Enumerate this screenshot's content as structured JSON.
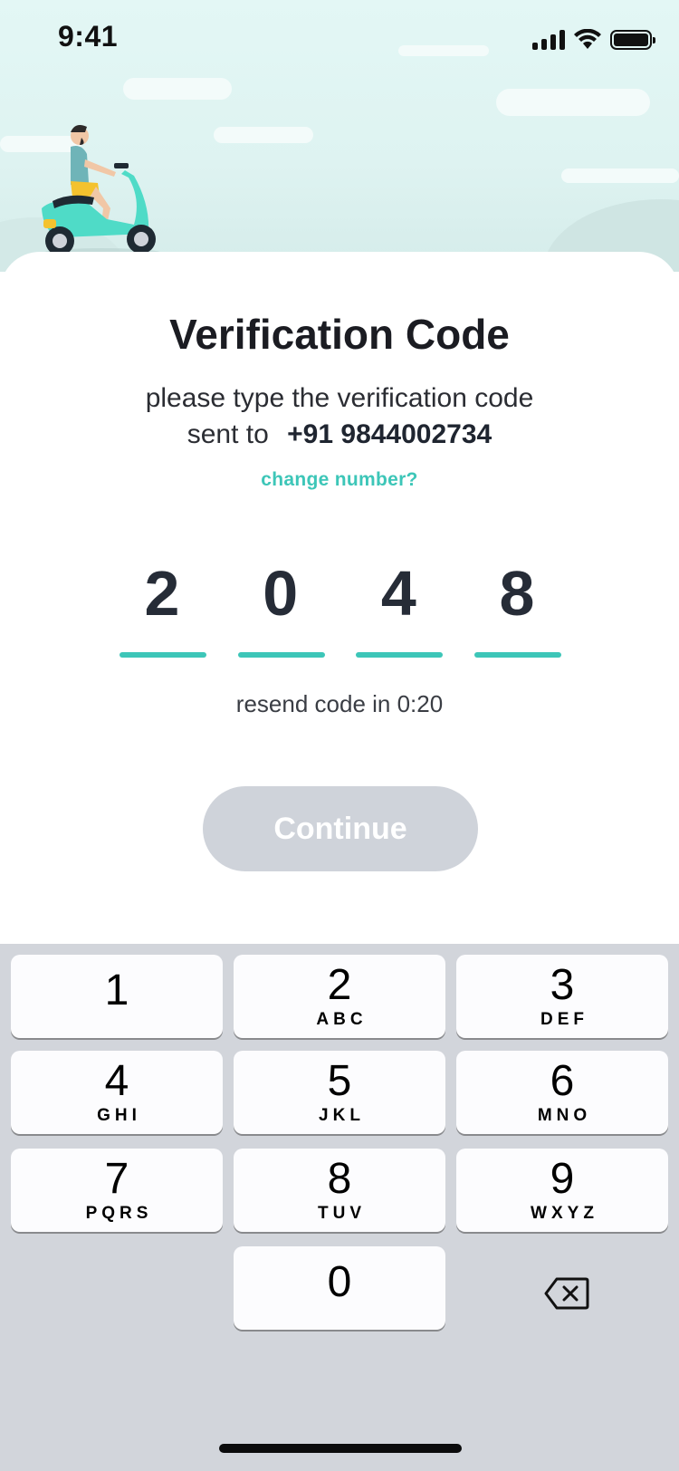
{
  "status_bar": {
    "time": "9:41",
    "icons": [
      "cellular-signal-icon",
      "wifi-icon",
      "battery-icon"
    ]
  },
  "header": {
    "illustration": "scooter-rider-illustration"
  },
  "verification": {
    "title": "Verification Code",
    "subtitle_line1": "please type the verification code",
    "subtitle_prefix": "sent to",
    "phone_number": "+91 9844002734",
    "change_number": "change number?",
    "otp_digits": [
      "2",
      "0",
      "4",
      "8"
    ],
    "resend_text": "resend code in 0:20",
    "continue_label": "Continue"
  },
  "keyboard": {
    "keys": [
      {
        "num": "1",
        "letters": ""
      },
      {
        "num": "2",
        "letters": "ABC"
      },
      {
        "num": "3",
        "letters": "DEF"
      },
      {
        "num": "4",
        "letters": "GHI"
      },
      {
        "num": "5",
        "letters": "JKL"
      },
      {
        "num": "6",
        "letters": "MNO"
      },
      {
        "num": "7",
        "letters": "PQRS"
      },
      {
        "num": "8",
        "letters": "TUV"
      },
      {
        "num": "9",
        "letters": "WXYZ"
      },
      {
        "num": "0",
        "letters": ""
      }
    ],
    "backspace_icon": "backspace-icon"
  },
  "colors": {
    "accent": "#3dc6b8",
    "button_disabled": "#cfd3da",
    "keyboard_bg": "#d2d5db",
    "sky": "#e3f7f5"
  }
}
